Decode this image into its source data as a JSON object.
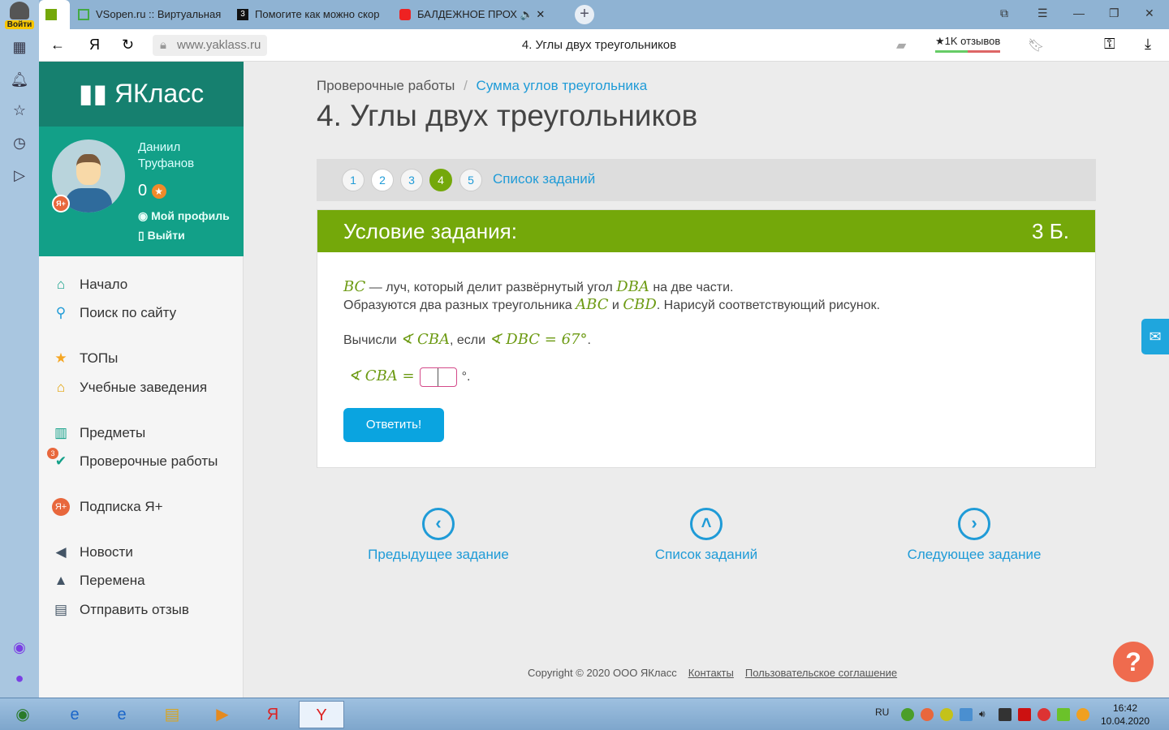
{
  "browser": {
    "login_label": "Войти",
    "tabs": [
      {
        "title": "VSopen.ru :: Виртуальная"
      },
      {
        "title": "Помогите как можно скор"
      },
      {
        "title": "БАЛДЕЖНОЕ ПРОХ"
      }
    ],
    "url": "www.yaklass.ru",
    "page_title": "4. Углы двух треугольников",
    "reviews": "★1K отзывов"
  },
  "site": {
    "brand": "ЯКласс",
    "user": {
      "first": "Даниил",
      "last": "Труфанов",
      "points": "0",
      "profile": "Мой профиль",
      "logout": "Выйти",
      "badge": "Я+"
    },
    "nav": [
      {
        "label": "Начало",
        "icon": "home-icon",
        "glyph": "⌂"
      },
      {
        "label": "Поиск по сайту",
        "icon": "search-icon",
        "glyph": "⚲"
      },
      {
        "label": "ТОПы",
        "icon": "star-icon",
        "glyph": "★"
      },
      {
        "label": "Учебные заведения",
        "icon": "school-icon",
        "glyph": "🏛"
      },
      {
        "label": "Предметы",
        "icon": "book-icon",
        "glyph": "📖"
      },
      {
        "label": "Проверочные работы",
        "icon": "check-icon",
        "glyph": "✔",
        "badge": "3"
      },
      {
        "label": "Подписка Я+",
        "icon": "subscription-icon",
        "glyph": "Я"
      },
      {
        "label": "Новости",
        "icon": "megaphone-icon",
        "glyph": "📣"
      },
      {
        "label": "Перемена",
        "icon": "bell-icon",
        "glyph": "🔔"
      },
      {
        "label": "Отправить отзыв",
        "icon": "feedback-icon",
        "glyph": "✉"
      }
    ]
  },
  "main": {
    "breadcrumb": {
      "parent": "Проверочные работы",
      "sep": "/",
      "current": "Сумма углов треугольника"
    },
    "title": "4. Углы двух треугольников",
    "pages": [
      "1",
      "2",
      "3",
      "4",
      "5"
    ],
    "current_page": "4",
    "task_list": "Список заданий",
    "card": {
      "header": "Условие задания:",
      "points": "3 Б.",
      "l1": {
        "m1": "BC",
        "t1": " — луч, который делит развёрнутый угол ",
        "m2": "DBA",
        "t2": " на две части."
      },
      "l2": {
        "t1": "Образуются два разных треугольника ",
        "m1": "ABC",
        "t2": " и ",
        "m2": "CBD",
        "t3": ". Нарисуй соответствующий рисунок."
      },
      "l3": {
        "t1": "Вычисли ",
        "m1": "∢ CBA",
        "t2": ", если ",
        "m2": "∢ DBC = 67°",
        "t3": "."
      },
      "answer": {
        "lhs": "∢ CBA =",
        "suffix": "°.",
        "value": ""
      },
      "submit": "Ответить!"
    },
    "nav": {
      "prev": "Предыдущее задание",
      "list": "Список заданий",
      "next": "Следующее задание"
    },
    "footer": {
      "copyright": "Copyright © 2020 ООО ЯКласс",
      "contacts": "Контакты",
      "agreement": "Пользовательское соглашение"
    }
  },
  "taskbar": {
    "lang": "RU",
    "time": "16:42",
    "date": "10.04.2020"
  },
  "colors": {
    "accent_green": "#74a80a",
    "teal": "#12a088",
    "link": "#1f9bd7",
    "button": "#0aa4e0"
  }
}
